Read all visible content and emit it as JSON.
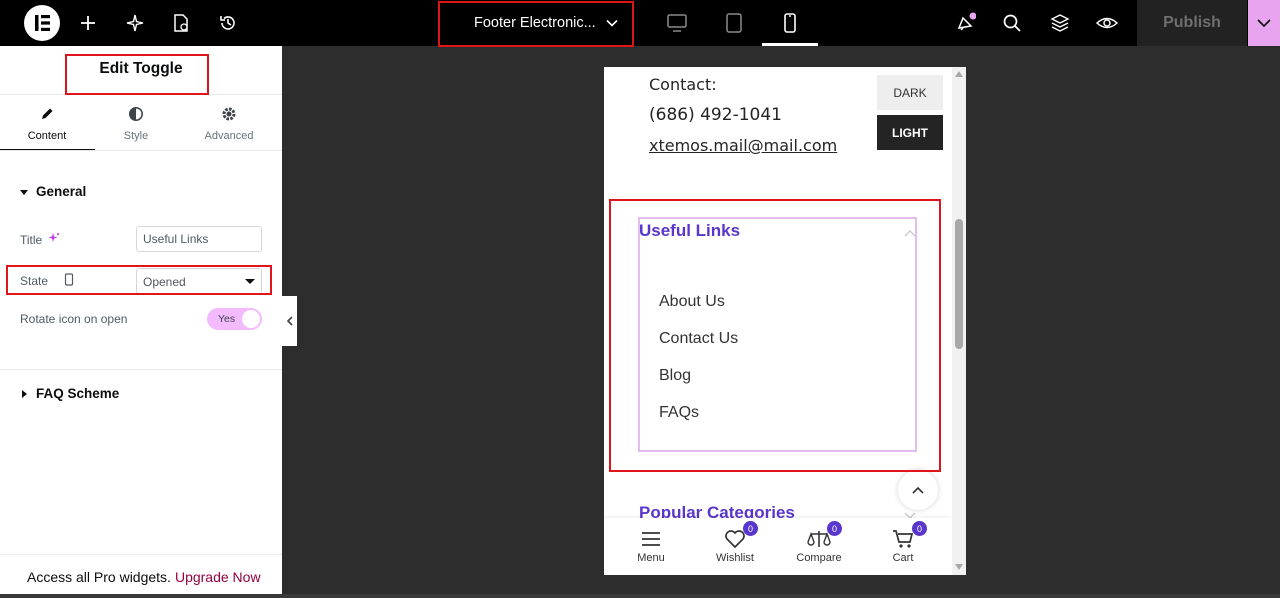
{
  "topbar": {
    "document_title": "Footer Electronic...",
    "publish_label": "Publish"
  },
  "panel": {
    "title": "Edit Toggle",
    "tabs": [
      {
        "label": "Content"
      },
      {
        "label": "Style"
      },
      {
        "label": "Advanced"
      }
    ],
    "general_section": "General",
    "title_label": "Title",
    "title_value": "Useful Links",
    "state_label": "State",
    "state_value": "Opened",
    "rotate_label": "Rotate icon on open",
    "rotate_value": "Yes",
    "faq_section": "FAQ Scheme",
    "promo_text": "Access all Pro widgets.",
    "promo_link": "Upgrade Now"
  },
  "preview": {
    "contact_label": "Contact:",
    "phone": "(686) 492-1041",
    "email": "xtemos.mail@mail.com",
    "dark_label": "DARK",
    "light_label": "LIGHT",
    "toggle_title": "Useful Links",
    "links": [
      "About Us",
      "Contact Us",
      "Blog",
      "FAQs"
    ],
    "next_toggle_title": "Popular Categories",
    "bottom_bar": [
      {
        "label": "Menu",
        "badge": ""
      },
      {
        "label": "Wishlist",
        "badge": "0"
      },
      {
        "label": "Compare",
        "badge": "0"
      },
      {
        "label": "Cart",
        "badge": "0"
      }
    ]
  },
  "colors": {
    "accent_purple": "#5936cc",
    "highlight_red": "#e0151b",
    "pink": "#e9a4ef",
    "promo_link": "#93003f"
  }
}
